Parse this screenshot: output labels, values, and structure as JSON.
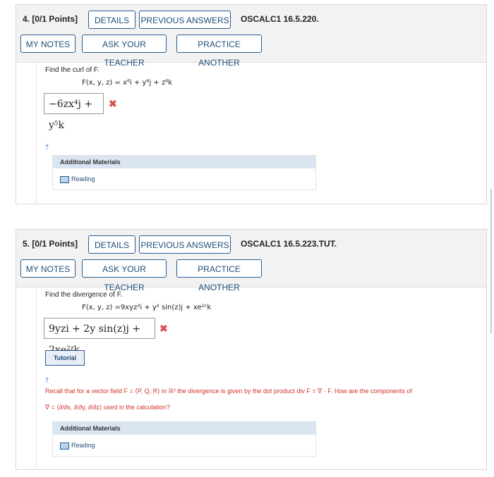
{
  "q4": {
    "number": "4.",
    "points": "[0/1 Points]",
    "details": "DETAILS",
    "previous_answers": "PREVIOUS ANSWERS",
    "reference": "OSCALC1 16.5.220.",
    "my_notes": "MY NOTES",
    "ask_teacher": "ASK YOUR TEACHER",
    "practice_another": "PRACTICE ANOTHER",
    "prompt": "Find the curl of F.",
    "formula": "F(x, y, z) = x⁶i + y⁶j + z⁶k",
    "answer": "−6zx⁴j + y⁵k",
    "status_icon": "x-mark",
    "dagger": "†",
    "additional_materials": "Additional Materials",
    "reading": "Reading"
  },
  "q5": {
    "number": "5.",
    "points": "[0/1 Points]",
    "details": "DETAILS",
    "previous_answers": "PREVIOUS ANSWERS",
    "reference": "OSCALC1 16.5.223.TUT.",
    "my_notes": "MY NOTES",
    "ask_teacher": "ASK YOUR TEACHER",
    "practice_another": "PRACTICE ANOTHER",
    "prompt": "Find the divergence of F.",
    "formula": "F(x, y, z) =9xyz²i + y² sin(z)j + xe²ᶻk",
    "answer": "9yzi + 2y sin(z)j + 2xe²ᶻk",
    "status_icon": "x-mark",
    "tutorial": "Tutorial",
    "dagger": "†",
    "hint_line1": "Recall that for a vector field F = ⟨P, Q, R⟩ in ℝ³ the divergence is given by the dot product div F = ∇ · F. How are the components of",
    "hint_line2": "∇ = ⟨∂/∂x, ∂/∂y, ∂/∂z⟩ used in the calculation?",
    "additional_materials": "Additional Materials",
    "reading": "Reading"
  },
  "colors": {
    "accent": "#2a5d8f",
    "error": "#d9534f",
    "header_bg": "#f2f2f2",
    "materials_header": "#dbe4f1"
  }
}
